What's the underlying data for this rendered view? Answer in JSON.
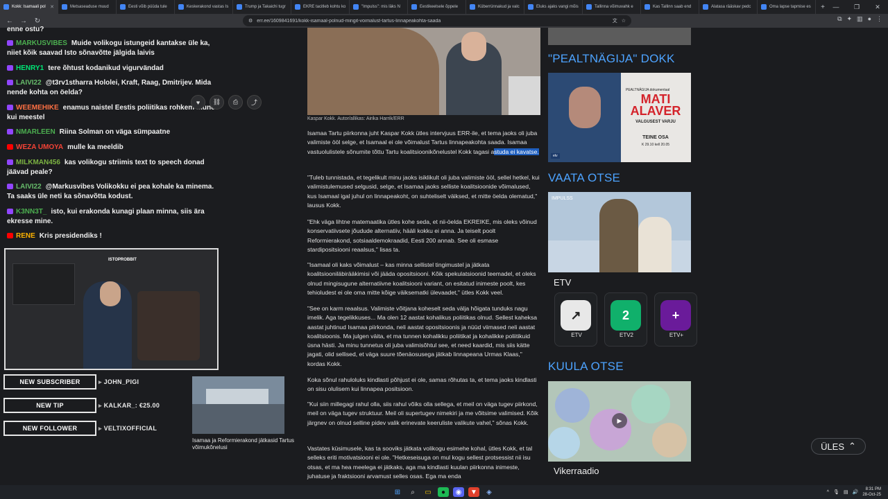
{
  "browser": {
    "tabs": [
      {
        "label": "Kokk: Isamaali pol"
      },
      {
        "label": "Metsaseaduse muud"
      },
      {
        "label": "Eesti võib püüda tule"
      },
      {
        "label": "Keskerakond vastas Is"
      },
      {
        "label": "Trump ja Takaichi tugr"
      },
      {
        "label": "EKRE tacitleb kohtu ko"
      },
      {
        "label": "\"Impulss\": mis läks N"
      },
      {
        "label": "Eestikeelsele õppele"
      },
      {
        "label": "Küberrünnakud ja valc"
      },
      {
        "label": "Eluks ajaks vangi mõis"
      },
      {
        "label": "Tallinna võimuvahk e"
      },
      {
        "label": "Kas Tallinn saab end"
      },
      {
        "label": "Alatasa rääskav pedc"
      },
      {
        "label": "Oma lapse tapmise es"
      }
    ],
    "new_tab": "+",
    "url": "err.ee/1609841691/kokk-isamaal-polnud-mingit-voimalust-tartus-linnapeakohta-saada",
    "accent": "#4da3ff"
  },
  "overlay": {
    "chat": [
      {
        "platform": "twitch",
        "user": "",
        "user_color": "#ffffff",
        "text": "enne ostu?"
      },
      {
        "platform": "twitch",
        "user": "MARKUSVIBES",
        "user_color": "#4caf50",
        "text": "Muide volikogu istungeid kantakse üle ka, niiet kõik saavad Isto sõnavõtte jälgida laivis"
      },
      {
        "platform": "twitch",
        "user": "HENRY1",
        "user_color": "#00e676",
        "text": "tere õhtust kodanikud vigurvändad"
      },
      {
        "platform": "twitch",
        "user": "LAIVI22",
        "user_color": "#66bb6a",
        "text": "@t3rv1stharra Hololei, Kraft, Raag, Dmitrijev. Mida nende kohta on öelda?"
      },
      {
        "platform": "twitch",
        "user": "WEEMEHIKE",
        "user_color": "#ff7043",
        "text": "enamus naistel Eestis poliitikas rohkem mune kui meestel"
      },
      {
        "platform": "twitch",
        "user": "NMARLEEN",
        "user_color": "#4caf50",
        "text": "Riina Solman on väga sümpaatne"
      },
      {
        "platform": "yt",
        "user": "WEZA UMOYA",
        "user_color": "#f44336",
        "text": "mulle ka meeldib"
      },
      {
        "platform": "twitch",
        "user": "MILKMAN456",
        "user_color": "#7cb342",
        "text": "kas volikogu striimis text to speech donad jäävad peale?"
      },
      {
        "platform": "twitch",
        "user": "LAIVI22",
        "user_color": "#66bb6a",
        "text": "@Markusvibes Volikokku ei pea kohale ka minema. Ta saaks üle neti ka sõnavõtta kodust."
      },
      {
        "platform": "twitch",
        "user": "K3NN3T_",
        "user_color": "#4caf50",
        "text": "isto, kui erakonda kunagi plaan minna, siis ära ekresse mine."
      },
      {
        "platform": "yt",
        "user": "RENE",
        "user_color": "#ffb300",
        "text": "Kris presidendiks !"
      }
    ],
    "cam_sign": "ISTOPROBBIT",
    "alerts": [
      {
        "label": "NEW SUBSCRIBER",
        "value": "JOHN_PIGI"
      },
      {
        "label": "NEW TIP",
        "value": "KALKAR_: €25.00"
      },
      {
        "label": "NEW FOLLOWER",
        "value": "VELTIXOFFICIAL"
      }
    ]
  },
  "article": {
    "caption": "Kaspar Kokk. Autor/allikas: Airika Harrik/ERR",
    "lead_before": "Isamaa Tartu piirkonna juht Kaspar Kokk ütles intervjuus ERR-ile, et ",
    "lead_full": "Isamaa Tartu piirkonna juht Kaspar Kokk ütles intervjuus ERR-ile, et ",
    "paragraphs": [
      "\"Tuleb tunnistada, et tegelikult minu jaoks isiklikult oli juba valimiste ööl, sellel hetkel, kui valimistulemused selgusid, selge, et Isamaa jaoks selliste koalitsioonide võimalused, kus Isamaal igal juhul on linnapeakoht, on suhteliselt väiksed, et mitte öelda olematud,\" lausus Kokk.",
      "\"Ehk väga lihtne matemaatika ütles kohe seda, et nii-öelda EKREIKE, mis oleks võinud konservatiivsete jõudude alternatiiv, hääli kokku ei anna. Ja teiselt poolt Reformierakond, sotsiaaldemokraadid, Eesti 200 annab. See oli esmase stardipositsiooni reaalsus,\" lisas ta.",
      "\"Isamaal oli kaks võimalust – kas minna sellistel tingimustel ja jätkata koalitsiooniläbirääkimisi või jääda opositsiooni. Kõik spekulatsioonid teemadel, et oleks olnud mingisugune alternatiivne koalitsiooni variant, on esitatud inimeste poolt, kes tehioludest ei ole oma mitte kõige väiksematki ülevaadet,\" ütles Kokk veel.",
      "\"See on karm reaalsus. Valimiste võitjana koheselt seda välja hõigata tunduks nagu imelik. Aga tegelikkuses... Ma olen 12 aastat kohalikus poliitikas olnud. Sellest kaheksa aastat juhtinud Isamaa piirkonda, neli aastat opositsioonis ja nüüd viimased neli aastat koalitsioonis. Ma julgen väita, et ma tunnen kohalikku poliitikat ja kohalikke poliitikuid üsna hästi. Ja minu tunnetus oli juba valimisõhtul see, et need kaardid, mis siis kätte jagati, olid sellised, et väga suure tõenäosusega jätkab linnapeana Urmas Klaas,\" kordas Kokk.",
      "Koka sõnul rahuloluks kindlasti põhjust ei ole, samas rõhutas ta, et tema jaoks kindlasti on sisu olulisem kui linnapea positsioon.",
      "\"Kui siin millegagi rahul olla, siis rahul võiks olla sellega, et meil on väga tugev piirkond, meil on väga tugev struktuur. Meil oli supertugev nimekiri ja me võitsime valimised. Kõik järgnev on olnud selline pidev valik erinevate keeruliste valikute vahel,\" sõnas Kokk.",
      "Vastates küsimusele, kas ta sooviks jätkata volikogu esimehe kohal, ütles Kokk, et tal selleks eriti motivatsiooni ei ole. \"Hetkeseisuga on mul kogu sellest protsessist nii isu otsas, et ma hea meelega ei jätkaks, aga ma kindlasti kuulan piirkonna inimeste, juhatuse ja fraktsiooni arvamust selles osas. Ega ma enda"
    ],
    "lead_text": "Isamaa Tartu piirkonna juht Kaspar Kokk ütles intervjuus ERR-ile, et tema jaoks oli juba valimiste ööl selge, et Isamaal ei ole võimalust Tartus linnapeakohta saada. Isamaa vastuolulistele sõnumite tõttu Tartu koalitsioonikõnelustel Kokk tagasi a",
    "lead_highlight": "studa ei kavatse.",
    "related_caption": "Isamaa ja Reformierakond jätkasid Tartus võimukõnelusi"
  },
  "sidebar": {
    "dokk_title": "\"PEALTNÄGIJA\" DOKK",
    "dokk_pre": "PEALTNÄGIJA dokumentaal",
    "dokk_name": "MATI ALAVER",
    "dokk_sub": "VALGUSEST VARJU",
    "dokk_osa": "TEINE OSA",
    "dokk_date": "K 29.10 kell 20.05",
    "dokk_logo": "etv",
    "vaata_title": "VAATA OTSE",
    "live_tag": "IMPULSS",
    "etv_label": "ETV",
    "channels": [
      {
        "name": "ETV",
        "glyph": "↗",
        "bg": "#e8e8e8",
        "fg": "#222222"
      },
      {
        "name": "ETV2",
        "glyph": "2",
        "bg": "#10b06b",
        "fg": "#ffffff"
      },
      {
        "name": "ETV+",
        "glyph": "+",
        "bg": "#6a1b9a",
        "fg": "#ffffff"
      }
    ],
    "kuula_title": "KUULA OTSE",
    "radio_label": "Vikerraadio"
  },
  "ules": {
    "label": "ÜLES",
    "icon": "chevron-up-icon"
  },
  "taskbar": {
    "time": "8:31 PM",
    "date": "28-Oct-25"
  }
}
